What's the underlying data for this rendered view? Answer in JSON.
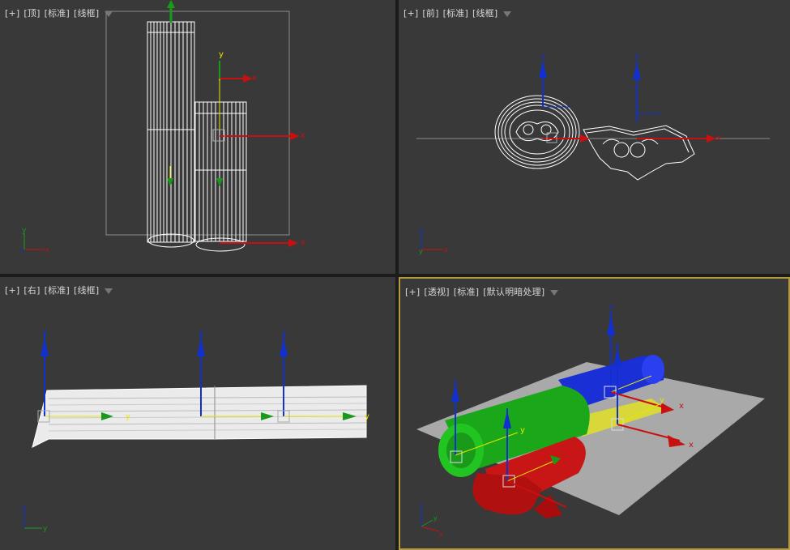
{
  "viewports": {
    "top": {
      "plus": "[+]",
      "view": "[顶]",
      "mode": "[标准]",
      "shading": "[线框]"
    },
    "front": {
      "plus": "[+]",
      "view": "[前]",
      "mode": "[标准]",
      "shading": "[线框]"
    },
    "right": {
      "plus": "[+]",
      "view": "[右]",
      "mode": "[标准]",
      "shading": "[线框]"
    },
    "persp": {
      "plus": "[+]",
      "view": "[透视]",
      "mode": "[标准]",
      "shading": "[默认明暗处理]"
    }
  },
  "axes": {
    "x": "x",
    "y": "y",
    "z": "z"
  },
  "colors": {
    "viewport_bg": "#393939",
    "active_border": "#b49a3c",
    "axis_x": "#c81010",
    "axis_y": "#1a9a1a",
    "axis_z": "#1030d0",
    "wire": "#ffffff"
  },
  "icons": [
    "filter-icon"
  ]
}
